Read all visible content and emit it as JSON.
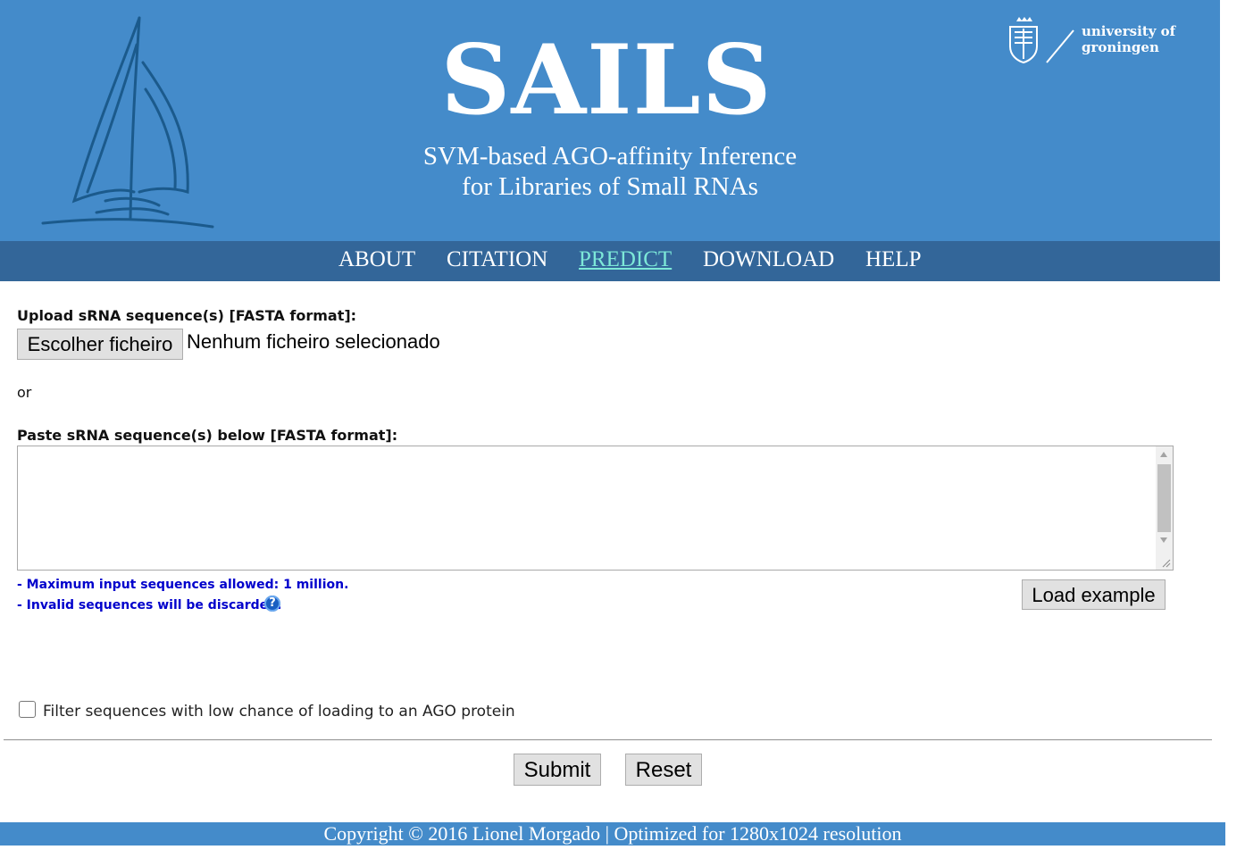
{
  "header": {
    "title": "SAILS",
    "subtitle_line1": "SVM-based AGO-affinity Inference",
    "subtitle_line2": "for Libraries of Small RNAs",
    "university_line1": "university of",
    "university_line2": "groningen"
  },
  "nav": {
    "items": [
      {
        "label": "ABOUT",
        "active": false
      },
      {
        "label": "CITATION",
        "active": false
      },
      {
        "label": "PREDICT",
        "active": true
      },
      {
        "label": "DOWNLOAD",
        "active": false
      },
      {
        "label": "HELP",
        "active": false
      }
    ]
  },
  "form": {
    "upload_label": "Upload sRNA sequence(s) [FASTA format]:",
    "file_button": "Escolher ficheiro",
    "file_status": "Nenhum ficheiro selecionado",
    "or_text": "or",
    "paste_label": "Paste sRNA sequence(s) below [FASTA format]:",
    "textarea_value": "",
    "note_max": "- Maximum input sequences allowed: 1 million.",
    "note_invalid": "- Invalid sequences will be discarded.",
    "help_glyph": "?",
    "load_example": "Load example",
    "filter_label": "Filter sequences with low chance of loading to an AGO protein",
    "filter_checked": false,
    "submit": "Submit",
    "reset": "Reset"
  },
  "footer": {
    "text": "Copyright © 2016 Lionel Morgado | Optimized for 1280x1024 resolution"
  },
  "colors": {
    "header_bg": "#448bca",
    "nav_bg": "#336699",
    "nav_active": "#7de8d8",
    "note_text": "#0000cc"
  }
}
